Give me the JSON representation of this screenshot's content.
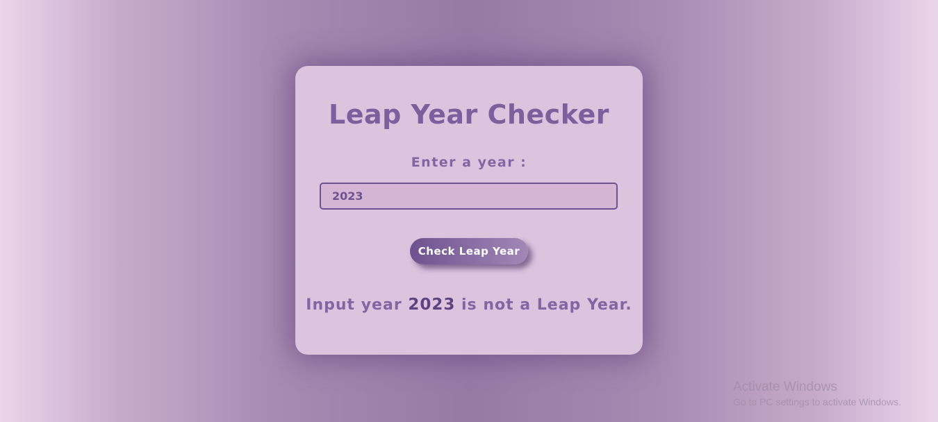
{
  "app": {
    "title": "Leap Year Checker",
    "label": "Enter a year :",
    "input_value": "2023",
    "button_label": "Check Leap Year",
    "result": {
      "prefix": "Input year ",
      "year": "2023",
      "suffix": " is not a Leap Year."
    }
  },
  "watermark": {
    "title": "Activate Windows",
    "subtitle": "Go to PC settings to activate Windows."
  },
  "colors": {
    "accent": "#7d5f9e",
    "card_background": "#dcc4df",
    "input_border": "#6e5290"
  }
}
